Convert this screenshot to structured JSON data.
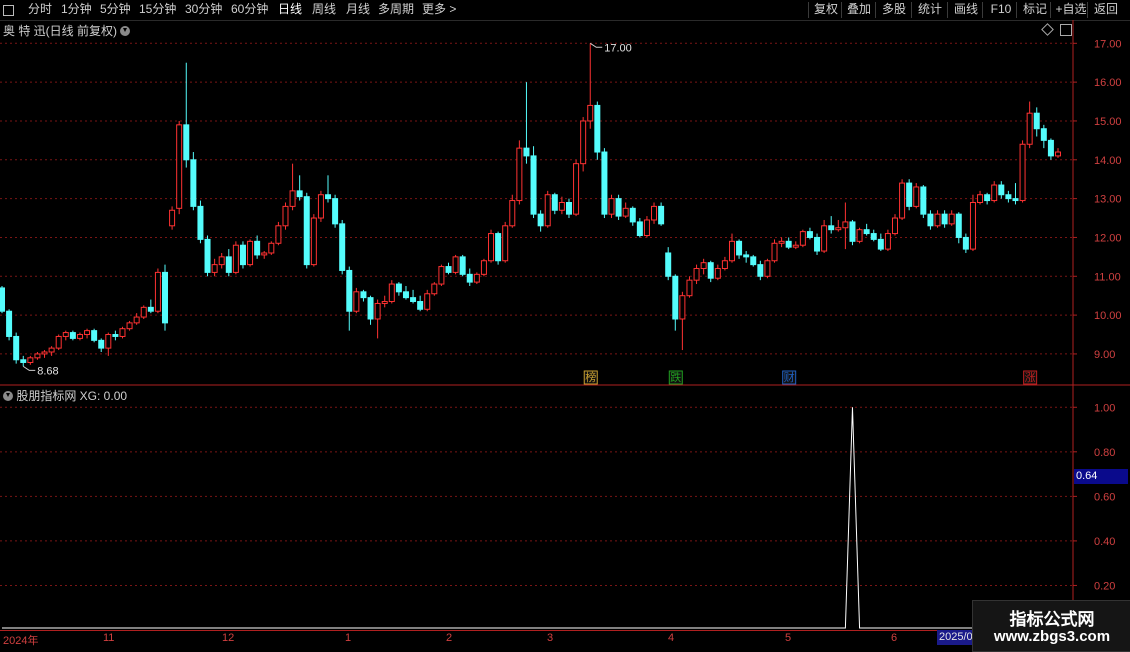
{
  "toolbar": {
    "periods": [
      "分时",
      "1分钟",
      "5分钟",
      "15分钟",
      "30分钟",
      "60分钟",
      "日线",
      "周线",
      "月线",
      "多周期",
      "更多 >"
    ],
    "active_period": "日线",
    "right_buttons": [
      "复权",
      "叠加",
      "多股",
      "统计",
      "画线",
      "F10",
      "标记",
      "+自选",
      "返回"
    ]
  },
  "kpanel": {
    "title": "奥 特 迅(日线 前复权)",
    "high_label": "17.00",
    "low_label": "8.68",
    "markers": [
      {
        "text": "榜",
        "color": "#c8a030"
      },
      {
        "text": "跌",
        "color": "#20a020"
      },
      {
        "text": "财",
        "color": "#2060c0"
      },
      {
        "text": "涨",
        "color": "#c02020"
      }
    ]
  },
  "ipanel": {
    "title": "股朋指标网 XG: 0.00",
    "current_value": "0.64"
  },
  "date_axis": {
    "labels": [
      "2024年",
      "11",
      "12",
      "1",
      "2",
      "3",
      "4",
      "5",
      "6"
    ],
    "highlight": "2025/0"
  },
  "watermark": {
    "line1": "指标公式网",
    "line2": "www.zbgs3.com"
  },
  "chart_data": [
    {
      "type": "candlestick",
      "title": "奥 特 迅(日线 前复权)",
      "y_ticks": [
        17.0,
        16.0,
        15.0,
        14.0,
        13.0,
        12.0,
        11.0,
        10.0,
        9.0
      ],
      "ylim": [
        8.2,
        17.6
      ],
      "up_color": "#ff3232",
      "down_color": "#54fcfc",
      "ohlc": [
        [
          10.7,
          10.75,
          10.05,
          10.1
        ],
        [
          10.1,
          10.15,
          9.35,
          9.45
        ],
        [
          9.45,
          9.55,
          8.75,
          8.85
        ],
        [
          8.85,
          8.95,
          8.68,
          8.78
        ],
        [
          8.78,
          8.95,
          8.72,
          8.9
        ],
        [
          8.9,
          9.05,
          8.85,
          9.0
        ],
        [
          9.0,
          9.1,
          8.9,
          9.05
        ],
        [
          9.05,
          9.2,
          8.95,
          9.15
        ],
        [
          9.15,
          9.5,
          9.1,
          9.45
        ],
        [
          9.45,
          9.6,
          9.35,
          9.55
        ],
        [
          9.55,
          9.6,
          9.35,
          9.4
        ],
        [
          9.4,
          9.55,
          9.35,
          9.5
        ],
        [
          9.5,
          9.65,
          9.4,
          9.6
        ],
        [
          9.6,
          9.65,
          9.3,
          9.35
        ],
        [
          9.35,
          9.4,
          9.05,
          9.15
        ],
        [
          9.15,
          9.55,
          8.95,
          9.5
        ],
        [
          9.5,
          9.6,
          9.35,
          9.45
        ],
        [
          9.45,
          9.7,
          9.4,
          9.65
        ],
        [
          9.65,
          9.85,
          9.6,
          9.8
        ],
        [
          9.8,
          10.05,
          9.75,
          9.95
        ],
        [
          9.95,
          10.25,
          9.9,
          10.2
        ],
        [
          10.2,
          10.4,
          10.05,
          10.1
        ],
        [
          10.1,
          11.2,
          10.05,
          11.1
        ],
        [
          11.1,
          11.3,
          9.6,
          9.8
        ],
        [
          12.3,
          12.8,
          12.2,
          12.7
        ],
        [
          12.75,
          15.0,
          12.6,
          14.9
        ],
        [
          14.9,
          16.5,
          13.8,
          14.0
        ],
        [
          14.0,
          14.2,
          12.7,
          12.8
        ],
        [
          12.8,
          12.95,
          11.85,
          11.95
        ],
        [
          11.95,
          12.05,
          11.0,
          11.1
        ],
        [
          11.1,
          11.45,
          11.0,
          11.3
        ],
        [
          11.3,
          11.6,
          11.2,
          11.5
        ],
        [
          11.5,
          11.7,
          11.0,
          11.1
        ],
        [
          11.1,
          11.9,
          11.05,
          11.8
        ],
        [
          11.8,
          11.9,
          11.2,
          11.3
        ],
        [
          11.3,
          11.95,
          11.25,
          11.9
        ],
        [
          11.9,
          12.05,
          11.45,
          11.55
        ],
        [
          11.55,
          11.65,
          11.45,
          11.6
        ],
        [
          11.6,
          11.9,
          11.55,
          11.85
        ],
        [
          11.85,
          12.4,
          11.8,
          12.3
        ],
        [
          12.3,
          12.9,
          12.2,
          12.8
        ],
        [
          12.8,
          13.9,
          12.7,
          13.2
        ],
        [
          13.2,
          13.6,
          12.95,
          13.05
        ],
        [
          13.05,
          13.15,
          11.2,
          11.3
        ],
        [
          11.3,
          12.6,
          11.25,
          12.5
        ],
        [
          12.5,
          13.2,
          12.4,
          13.1
        ],
        [
          13.1,
          13.6,
          12.9,
          13.0
        ],
        [
          13.0,
          13.1,
          12.25,
          12.35
        ],
        [
          12.35,
          12.45,
          11.05,
          11.15
        ],
        [
          11.15,
          11.25,
          9.6,
          10.1
        ],
        [
          10.1,
          10.7,
          10.05,
          10.6
        ],
        [
          10.6,
          10.65,
          10.35,
          10.45
        ],
        [
          10.45,
          10.5,
          9.75,
          9.9
        ],
        [
          9.9,
          10.4,
          9.4,
          10.3
        ],
        [
          10.3,
          10.5,
          10.2,
          10.35
        ],
        [
          10.35,
          10.9,
          10.3,
          10.8
        ],
        [
          10.8,
          10.85,
          10.5,
          10.6
        ],
        [
          10.6,
          10.75,
          10.4,
          10.45
        ],
        [
          10.45,
          10.65,
          10.3,
          10.35
        ],
        [
          10.35,
          10.5,
          10.1,
          10.15
        ],
        [
          10.15,
          10.65,
          10.1,
          10.55
        ],
        [
          10.55,
          10.85,
          10.5,
          10.8
        ],
        [
          10.8,
          11.3,
          10.75,
          11.25
        ],
        [
          11.25,
          11.35,
          11.05,
          11.1
        ],
        [
          11.1,
          11.55,
          11.05,
          11.5
        ],
        [
          11.5,
          11.55,
          11.0,
          11.05
        ],
        [
          11.05,
          11.2,
          10.75,
          10.85
        ],
        [
          10.85,
          11.1,
          10.8,
          11.05
        ],
        [
          11.05,
          11.45,
          11.0,
          11.4
        ],
        [
          11.4,
          12.2,
          11.35,
          12.1
        ],
        [
          12.1,
          12.15,
          11.3,
          11.4
        ],
        [
          11.4,
          12.4,
          11.35,
          12.3
        ],
        [
          12.3,
          13.1,
          12.25,
          12.95
        ],
        [
          12.95,
          14.5,
          12.85,
          14.3
        ],
        [
          14.3,
          16.0,
          13.9,
          14.1
        ],
        [
          14.1,
          14.35,
          12.5,
          12.6
        ],
        [
          12.6,
          12.7,
          12.15,
          12.3
        ],
        [
          12.3,
          13.2,
          12.25,
          13.1
        ],
        [
          13.1,
          13.15,
          12.6,
          12.7
        ],
        [
          12.7,
          13.05,
          12.6,
          12.9
        ],
        [
          12.9,
          13.0,
          12.5,
          12.6
        ],
        [
          12.6,
          14.0,
          12.55,
          13.9
        ],
        [
          13.9,
          15.1,
          13.7,
          15.0
        ],
        [
          15.0,
          17.0,
          14.8,
          15.4
        ],
        [
          15.4,
          15.5,
          14.0,
          14.2
        ],
        [
          14.2,
          14.3,
          12.5,
          12.6
        ],
        [
          12.6,
          13.1,
          12.5,
          13.0
        ],
        [
          13.0,
          13.1,
          12.45,
          12.55
        ],
        [
          12.55,
          12.9,
          12.5,
          12.75
        ],
        [
          12.75,
          12.8,
          12.3,
          12.4
        ],
        [
          12.4,
          12.5,
          12.0,
          12.05
        ],
        [
          12.05,
          12.55,
          12.0,
          12.45
        ],
        [
          12.45,
          12.9,
          12.35,
          12.8
        ],
        [
          12.8,
          12.9,
          12.3,
          12.35
        ],
        [
          11.6,
          11.75,
          10.9,
          11.0
        ],
        [
          11.0,
          11.05,
          9.6,
          9.9
        ],
        [
          9.9,
          10.6,
          9.1,
          10.5
        ],
        [
          10.5,
          11.0,
          10.45,
          10.9
        ],
        [
          10.9,
          11.3,
          10.8,
          11.2
        ],
        [
          11.2,
          11.45,
          11.05,
          11.35
        ],
        [
          11.35,
          11.4,
          10.85,
          10.95
        ],
        [
          10.95,
          11.3,
          10.9,
          11.2
        ],
        [
          11.2,
          11.5,
          11.15,
          11.4
        ],
        [
          11.4,
          12.1,
          11.35,
          11.9
        ],
        [
          11.9,
          11.95,
          11.45,
          11.55
        ],
        [
          11.55,
          11.65,
          11.35,
          11.5
        ],
        [
          11.5,
          11.55,
          11.25,
          11.3
        ],
        [
          11.3,
          11.4,
          10.9,
          11.0
        ],
        [
          11.0,
          11.45,
          10.95,
          11.4
        ],
        [
          11.4,
          11.95,
          11.35,
          11.85
        ],
        [
          11.85,
          12.0,
          11.75,
          11.9
        ],
        [
          11.9,
          12.0,
          11.7,
          11.75
        ],
        [
          11.75,
          11.9,
          11.7,
          11.8
        ],
        [
          11.8,
          12.2,
          11.75,
          12.15
        ],
        [
          12.15,
          12.25,
          11.95,
          12.0
        ],
        [
          12.0,
          12.1,
          11.55,
          11.65
        ],
        [
          11.65,
          12.45,
          11.6,
          12.3
        ],
        [
          12.3,
          12.55,
          12.1,
          12.2
        ],
        [
          12.2,
          12.45,
          12.15,
          12.25
        ],
        [
          12.25,
          12.9,
          11.7,
          12.4
        ],
        [
          12.4,
          12.45,
          11.8,
          11.9
        ],
        [
          11.9,
          12.25,
          11.85,
          12.2
        ],
        [
          12.2,
          12.35,
          12.05,
          12.1
        ],
        [
          12.1,
          12.2,
          11.9,
          11.95
        ],
        [
          11.95,
          12.1,
          11.65,
          11.7
        ],
        [
          11.7,
          12.2,
          11.65,
          12.1
        ],
        [
          12.1,
          12.6,
          12.05,
          12.5
        ],
        [
          12.5,
          13.5,
          12.45,
          13.4
        ],
        [
          13.4,
          13.5,
          12.7,
          12.8
        ],
        [
          12.8,
          13.4,
          12.75,
          13.3
        ],
        [
          13.3,
          13.35,
          12.5,
          12.6
        ],
        [
          12.6,
          12.7,
          12.2,
          12.3
        ],
        [
          12.3,
          12.7,
          12.25,
          12.6
        ],
        [
          12.6,
          12.7,
          12.25,
          12.35
        ],
        [
          12.35,
          12.7,
          12.3,
          12.6
        ],
        [
          12.6,
          12.65,
          11.85,
          12.0
        ],
        [
          12.0,
          12.1,
          11.6,
          11.7
        ],
        [
          11.7,
          13.1,
          11.65,
          12.9
        ],
        [
          12.9,
          13.2,
          12.85,
          13.1
        ],
        [
          13.1,
          13.15,
          12.85,
          12.95
        ],
        [
          12.95,
          13.45,
          12.9,
          13.35
        ],
        [
          13.35,
          13.45,
          13.0,
          13.1
        ],
        [
          13.1,
          13.2,
          12.9,
          13.0
        ],
        [
          13.0,
          13.4,
          12.85,
          12.95
        ],
        [
          12.95,
          14.5,
          12.9,
          14.4
        ],
        [
          14.4,
          15.5,
          14.3,
          15.2
        ],
        [
          15.2,
          15.35,
          14.6,
          14.8
        ],
        [
          14.8,
          14.9,
          14.3,
          14.5
        ],
        [
          14.5,
          14.55,
          14.0,
          14.1
        ],
        [
          14.1,
          14.3,
          14.05,
          14.2
        ]
      ]
    },
    {
      "type": "line",
      "title": "股朋指标网 XG: 0.00",
      "y_ticks": [
        1.0,
        0.8,
        0.6,
        0.4,
        0.2
      ],
      "ylim": [
        0,
        1.1
      ],
      "values_nonzero": {
        "index": 120,
        "value": 1.0
      },
      "count": 148
    }
  ]
}
